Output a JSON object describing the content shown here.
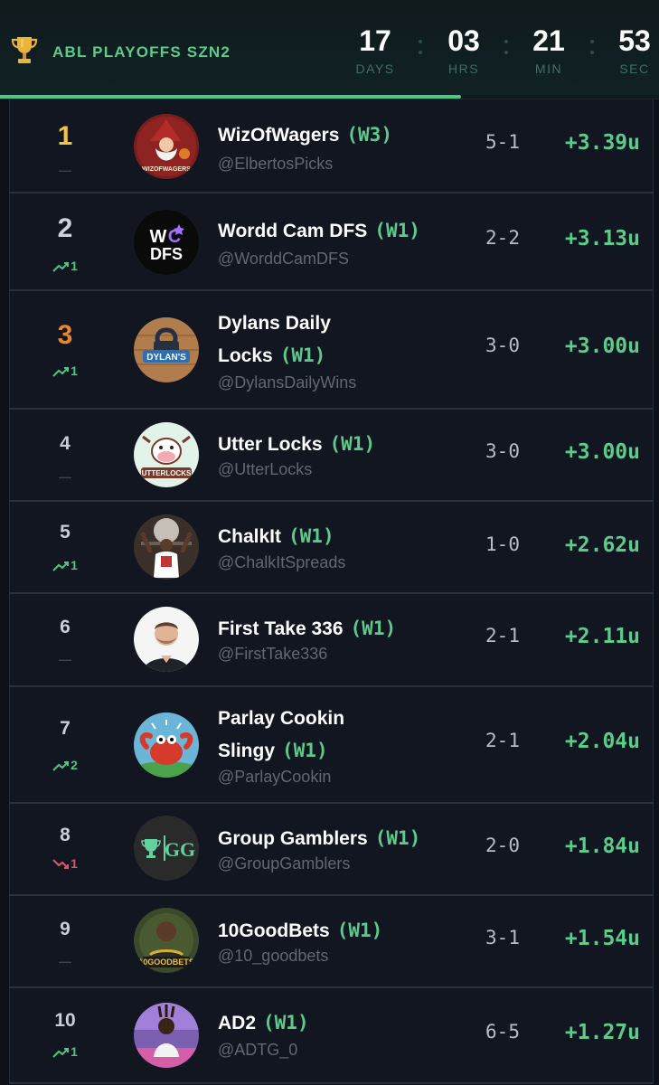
{
  "header": {
    "title": "ABL PLAYOFFS SZN2",
    "progress_fraction": 0.7,
    "countdown": [
      {
        "value": "17",
        "label": "DAYS"
      },
      {
        "value": "03",
        "label": "HRS"
      },
      {
        "value": "21",
        "label": "MIN"
      },
      {
        "value": "53",
        "label": "SEC"
      }
    ]
  },
  "colors": {
    "accent_green": "#5ccb8c",
    "gold": "#f3c248",
    "bronze": "#e6892d",
    "down_red": "#e5536a",
    "background": "#0d1117"
  },
  "rows": [
    {
      "rank": "1",
      "movement": "same",
      "movement_value": "",
      "name_line1": "WizOfWagers",
      "name_line2": "",
      "week": "(W3)",
      "handle": "@ElbertosPicks",
      "record": "5-1",
      "units": "+3.39u",
      "avatar_icon": "wizard-avatar-icon"
    },
    {
      "rank": "2",
      "movement": "up",
      "movement_value": "1",
      "name_line1": "Wordd Cam DFS",
      "name_line2": "",
      "week": "(W1)",
      "handle": "@WorddCamDFS",
      "record": "2-2",
      "units": "+3.13u",
      "avatar_icon": "wcdfs-logo-icon"
    },
    {
      "rank": "3",
      "movement": "up",
      "movement_value": "1",
      "name_line1": "Dylans Daily",
      "name_line2": "Locks",
      "week": "(W1)",
      "handle": "@DylansDailyWins",
      "record": "3-0",
      "units": "+3.00u",
      "avatar_icon": "dylans-lock-icon"
    },
    {
      "rank": "4",
      "movement": "same",
      "movement_value": "",
      "name_line1": "Utter Locks",
      "name_line2": "",
      "week": "(W1)",
      "handle": "@UtterLocks",
      "record": "3-0",
      "units": "+3.00u",
      "avatar_icon": "cow-avatar-icon"
    },
    {
      "rank": "5",
      "movement": "up",
      "movement_value": "1",
      "name_line1": "ChalkIt",
      "name_line2": "",
      "week": "(W1)",
      "handle": "@ChalkItSpreads",
      "record": "1-0",
      "units": "+2.62u",
      "avatar_icon": "player-photo-icon"
    },
    {
      "rank": "6",
      "movement": "same",
      "movement_value": "",
      "name_line1": "First Take 336",
      "name_line2": "",
      "week": "(W1)",
      "handle": "@FirstTake336",
      "record": "2-1",
      "units": "+2.11u",
      "avatar_icon": "man-photo-icon"
    },
    {
      "rank": "7",
      "movement": "up",
      "movement_value": "2",
      "name_line1": "Parlay Cookin",
      "name_line2": "Slingy",
      "week": "(W1)",
      "handle": "@ParlayCookin",
      "record": "2-1",
      "units": "+2.04u",
      "avatar_icon": "crab-avatar-icon"
    },
    {
      "rank": "8",
      "movement": "down",
      "movement_value": "1",
      "name_line1": "Group Gamblers",
      "name_line2": "",
      "week": "(W1)",
      "handle": "@GroupGamblers",
      "record": "2-0",
      "units": "+1.84u",
      "avatar_icon": "gg-logo-icon"
    },
    {
      "rank": "9",
      "movement": "same",
      "movement_value": "",
      "name_line1": "10GoodBets",
      "name_line2": "",
      "week": "(W1)",
      "handle": "@10_goodbets",
      "record": "3-1",
      "units": "+1.54u",
      "avatar_icon": "goodbets-avatar-icon"
    },
    {
      "rank": "10",
      "movement": "up",
      "movement_value": "1",
      "name_line1": "AD2",
      "name_line2": "",
      "week": "(W1)",
      "handle": "@ADTG_0",
      "record": "6-5",
      "units": "+1.27u",
      "avatar_icon": "person-photo-icon"
    }
  ]
}
